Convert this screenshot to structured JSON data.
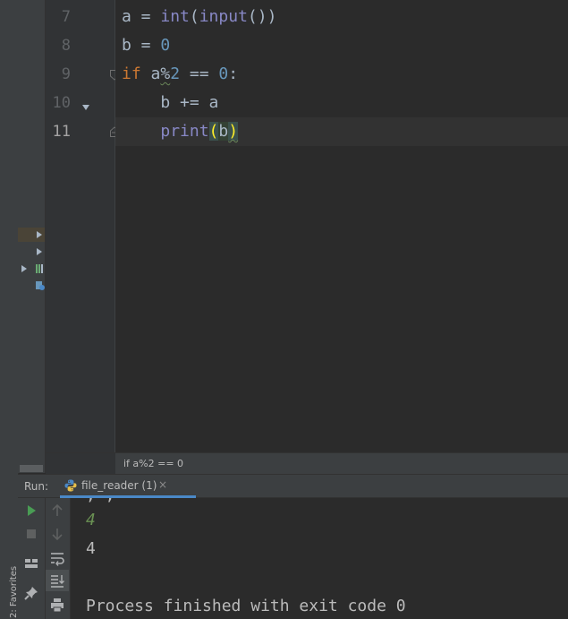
{
  "editor": {
    "lines": [
      {
        "no": "7",
        "code": "a = int(input())"
      },
      {
        "no": "8",
        "code": "b = 0"
      },
      {
        "no": "9",
        "code": "if a%2 == 0:"
      },
      {
        "no": "10",
        "code": "    b += a"
      },
      {
        "no": "11",
        "code": "    print(b)"
      }
    ],
    "current_line": "11"
  },
  "breadcrumb": {
    "text": "if a%2 == 0"
  },
  "sidebar": {
    "favorites_label": "2: Favorites"
  },
  "run": {
    "label": "Run:",
    "tab_name": "file_reader (1)",
    "console": {
      "partial_top": ", ,",
      "input_echo": "4",
      "output": "4",
      "exit_message": "Process finished with exit code 0"
    }
  },
  "colors": {
    "keyword": "#cc7832",
    "builtin": "#8888c6",
    "number": "#6897bb",
    "text": "#a9b7c6",
    "run_green": "#499c54",
    "tab_underline": "#4a88c7"
  }
}
